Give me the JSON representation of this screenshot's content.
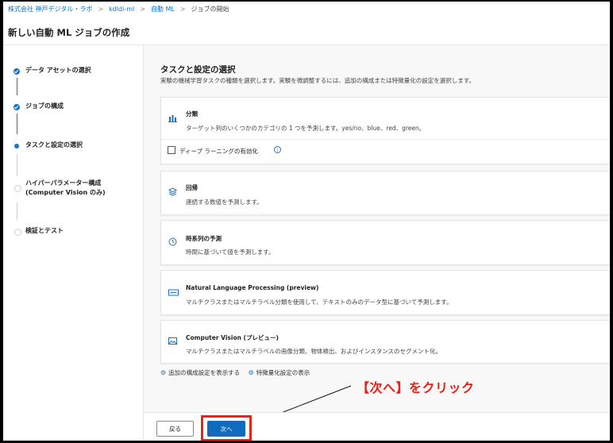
{
  "breadcrumb": [
    "株式会社 神戸デジタル・ラボ",
    "kdldi-ml",
    "自動 ML",
    "ジョブの開始"
  ],
  "page_title": "新しい自動 ML ジョブの作成",
  "stepper": {
    "steps": [
      {
        "label": "データ アセットの選択",
        "state": "done"
      },
      {
        "label": "ジョブの構成",
        "state": "done"
      },
      {
        "label": "タスクと設定の選択",
        "state": "current"
      },
      {
        "label": "ハイパーパラメーター構成",
        "label2": "(Computer Vision のみ)",
        "state": "todo"
      },
      {
        "label": "検証とテスト",
        "state": "todo"
      }
    ]
  },
  "main": {
    "title": "タスクと設定の選択",
    "description": "実験の機械学習タスクの種類を選択します。実験を微調整するには、追加の構成または特徴量化の設定を選択します。",
    "tasks": [
      {
        "title": "分類",
        "description": "ターゲット列のいくつかのカテゴリの 1 つを予測します。yes/no、blue、red、green。",
        "icon": "bar-chart-icon"
      },
      {
        "title": "回帰",
        "description": "連続する数値を予測します。",
        "icon": "layers-icon"
      },
      {
        "title": "時系列の予測",
        "description": "時間に基づいて値を予測します。",
        "icon": "clock-icon"
      },
      {
        "title": "Natural Language Processing (preview)",
        "description": "マルチクラスまたはマルチラベル分類を使用して、テキストのみのデータ型に基づいて予測します。",
        "icon": "text-icon"
      },
      {
        "title": "Computer Vision (プレビュー)",
        "description": "マルチクラスまたはマルチラベルの画像分類、物体検出、およびインスタンスのセグメント化。",
        "icon": "image-icon"
      }
    ],
    "deep_learning_label": "ディープ ラーニングの有効化",
    "links": {
      "additional_config": "追加の構成設定を表示する",
      "featurization": "特徴量化設定の表示"
    }
  },
  "footer": {
    "back_label": "戻る",
    "next_label": "次へ"
  },
  "annotation": {
    "text": "【次へ】をクリック",
    "color": "#e8211a"
  },
  "colors": {
    "accent": "#0f6cbd"
  }
}
